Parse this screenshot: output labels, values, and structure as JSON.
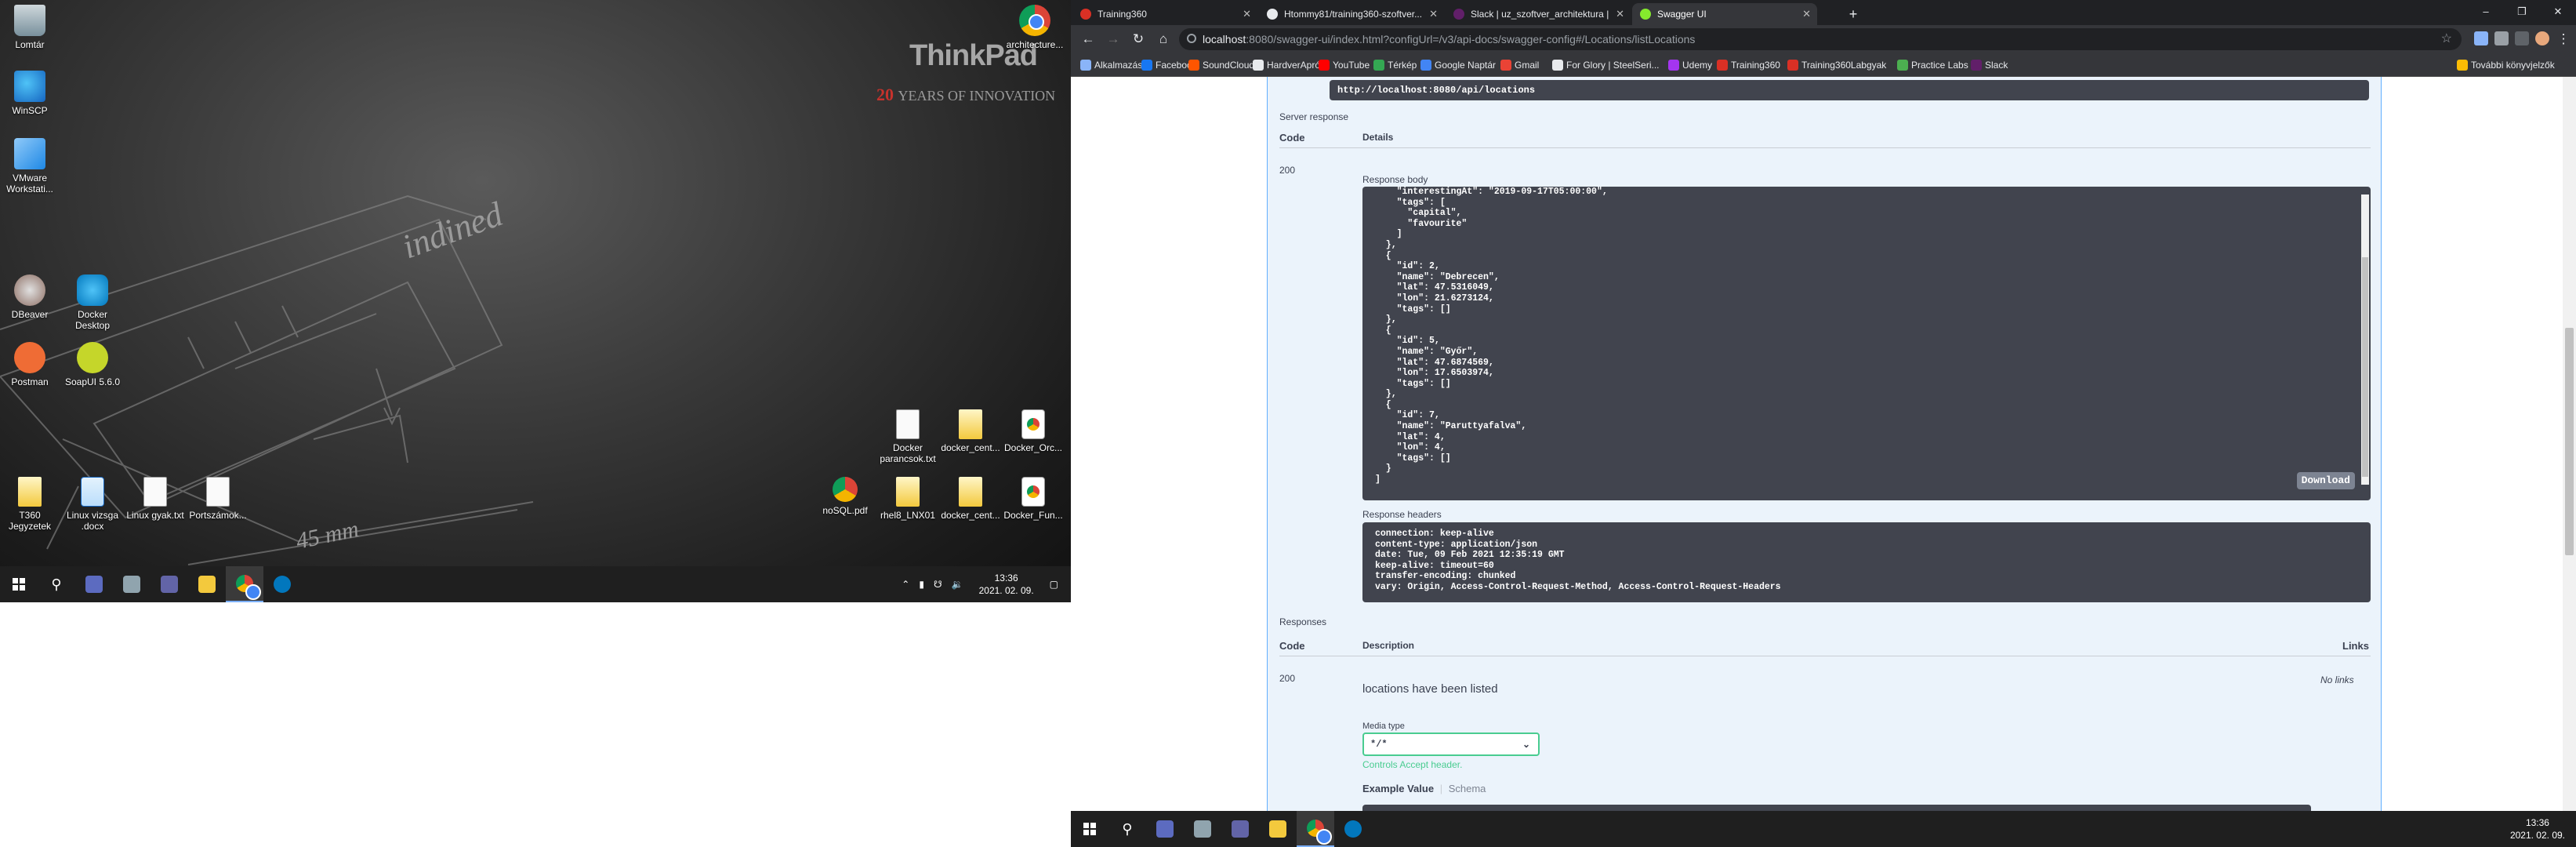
{
  "left_desktop": {
    "brand": "ThinkPad",
    "brand_sub_number": "20",
    "brand_sub_text": "YEARS OF INNOVATION",
    "sketch_text_1": "indined",
    "sketch_text_2": "45 mm",
    "icons": [
      {
        "label": "Lomtár",
        "icon": "recycle-bin-icon"
      },
      {
        "label": "WinSCP",
        "icon": "winscp-icon"
      },
      {
        "label": "VMware Workstati...",
        "icon": "vmware-icon"
      },
      {
        "label": "DBeaver",
        "icon": "dbeaver-icon"
      },
      {
        "label": "Docker Desktop",
        "icon": "docker-icon"
      },
      {
        "label": "Postman",
        "icon": "postman-icon"
      },
      {
        "label": "SoapUI 5.6.0",
        "icon": "soapui-icon"
      },
      {
        "label": "T360 Jegyzetek",
        "icon": "folder-icon"
      },
      {
        "label": "Linux vizsga .docx",
        "icon": "word-doc-icon"
      },
      {
        "label": "Linux gyak.txt",
        "icon": "text-file-icon"
      },
      {
        "label": "Portszámok...",
        "icon": "text-file-icon"
      },
      {
        "label": "architecture...",
        "icon": "chrome-icon"
      },
      {
        "label": "Docker parancsok.txt",
        "icon": "text-file-icon"
      },
      {
        "label": "docker_cent...",
        "icon": "folder-icon"
      },
      {
        "label": "Docker_Orc...",
        "icon": "chrome-file-icon"
      },
      {
        "label": "noSQL.pdf",
        "icon": "chrome-pdf-icon"
      },
      {
        "label": "rhel8_LNX01",
        "icon": "folder-icon"
      },
      {
        "label": "docker_cent...",
        "icon": "folder-icon"
      },
      {
        "label": "Docker_Fun...",
        "icon": "chrome-file-icon"
      }
    ],
    "clock_time": "13:36",
    "clock_date": "2021. 02. 09."
  },
  "browser": {
    "tabs": [
      {
        "label": "Training360",
        "fav": "#d93025"
      },
      {
        "label": "Htommy81/training360-szoftver...",
        "fav": "#e8eaed"
      },
      {
        "label": "Slack | uz_szoftver_architektura |",
        "fav": "#611f69"
      },
      {
        "label": "Swagger UI",
        "fav": "#85ea2d"
      }
    ],
    "url_host": "localhost",
    "url_rest": ":8080/swagger-ui/index.html?configUrl=/v3/api-docs/swagger-config#/Locations/listLocations",
    "bookmarks": [
      {
        "label": "Alkalmazások",
        "color": "#8ab4f8"
      },
      {
        "label": "Facebook",
        "color": "#1877f2"
      },
      {
        "label": "SoundCloud",
        "color": "#ff5500"
      },
      {
        "label": "HardverApró",
        "color": "#e8eaed"
      },
      {
        "label": "YouTube",
        "color": "#ff0000"
      },
      {
        "label": "Térkép",
        "color": "#34a853"
      },
      {
        "label": "Google Naptár",
        "color": "#4285f4"
      },
      {
        "label": "Gmail",
        "color": "#ea4335"
      },
      {
        "label": "For Glory | SteelSeri...",
        "color": "#e8eaed"
      },
      {
        "label": "Udemy",
        "color": "#a435f0"
      },
      {
        "label": "Training360",
        "color": "#d93025"
      },
      {
        "label": "Training360Labgyak",
        "color": "#d93025"
      },
      {
        "label": "Practice Labs",
        "color": "#4caf50"
      },
      {
        "label": "Slack",
        "color": "#611f69"
      },
      {
        "label": "További könyvjelzők",
        "color": "#fbbc04"
      }
    ]
  },
  "swagger": {
    "request_url": "http://localhost:8080/api/locations",
    "server_response_label": "Server response",
    "code_col": "Code",
    "details_col": "Details",
    "status_code": "200",
    "response_body_label": "Response body",
    "response_body": "    \"interestingAt\": \"2019-09-17T05:00:00\",\n    \"tags\": [\n      \"capital\",\n      \"favourite\"\n    ]\n  },\n  {\n    \"id\": 2,\n    \"name\": \"Debrecen\",\n    \"lat\": 47.5316049,\n    \"lon\": 21.6273124,\n    \"tags\": []\n  },\n  {\n    \"id\": 5,\n    \"name\": \"Győr\",\n    \"lat\": 47.6874569,\n    \"lon\": 17.6503974,\n    \"tags\": []\n  },\n  {\n    \"id\": 7,\n    \"name\": \"Paruttyafalva\",\n    \"lat\": 4,\n    \"lon\": 4,\n    \"tags\": []\n  }\n]",
    "download_label": "Download",
    "response_headers_label": "Response headers",
    "response_headers": "connection: keep-alive\ncontent-type: application/json\ndate: Tue, 09 Feb 2021 12:35:19 GMT\nkeep-alive: timeout=60\ntransfer-encoding: chunked\nvary: Origin, Access-Control-Request-Method, Access-Control-Request-Headers",
    "responses_label": "Responses",
    "description_col": "Description",
    "links_col": "Links",
    "resp_code": "200",
    "resp_desc": "locations have been listed",
    "no_links": "No links",
    "media_type_label": "Media type",
    "media_type_value": "*/*",
    "accept_note": "Controls Accept header.",
    "example_value_tab": "Example Value",
    "schema_tab": "Schema"
  },
  "right_taskbar": {
    "clock_time": "13:36",
    "clock_date": "2021. 02. 09."
  }
}
